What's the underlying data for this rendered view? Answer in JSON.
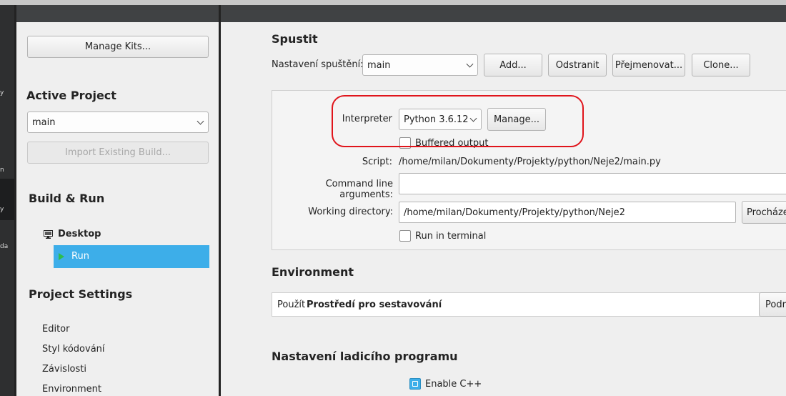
{
  "modebar": {
    "texts": [
      "y",
      "n",
      "y",
      "da"
    ]
  },
  "sidebar": {
    "manage_kits_label": "Manage Kits...",
    "active_project_heading": "Active Project",
    "project_selected": "main",
    "import_build_label": "Import Existing Build...",
    "build_run_heading": "Build & Run",
    "desktop_label": "Desktop",
    "run_label": "Run",
    "project_settings_heading": "Project Settings",
    "settings_items": [
      "Editor",
      "Styl kódování",
      "Závislosti",
      "Environment"
    ]
  },
  "run_section": {
    "heading": "Spustit",
    "run_config_label": "Nastavení spuštění:",
    "run_config_value": "main",
    "add_label": "Add...",
    "remove_label": "Odstranit",
    "rename_label": "Přejmenovat...",
    "clone_label": "Clone..."
  },
  "run_config": {
    "interpreter_label": "Interpreter",
    "interpreter_value": "Python 3.6.12",
    "manage_label": "Manage...",
    "buffered_output_label": "Buffered output",
    "script_label": "Script:",
    "script_value": "/home/milan/Dokumenty/Projekty/python/Neje2/main.py",
    "args_label": "Command line arguments:",
    "args_value": "",
    "workdir_label": "Working directory:",
    "workdir_value": "/home/milan/Dokumenty/Projekty/python/Neje2",
    "browse_label": "Procháze",
    "run_in_terminal_label": "Run in terminal"
  },
  "environment": {
    "heading": "Environment",
    "use_prefix": "Použít",
    "use_value": "Prostředí pro sestavování",
    "details_label": "Podr"
  },
  "debugger": {
    "heading": "Nastavení ladicího programu",
    "enable_cpp_label": "Enable C++",
    "enable_cpp_checked": true
  },
  "colors": {
    "accent": "#3daee9",
    "highlight": "#e0141b",
    "run_arrow": "#2ebd4d"
  }
}
